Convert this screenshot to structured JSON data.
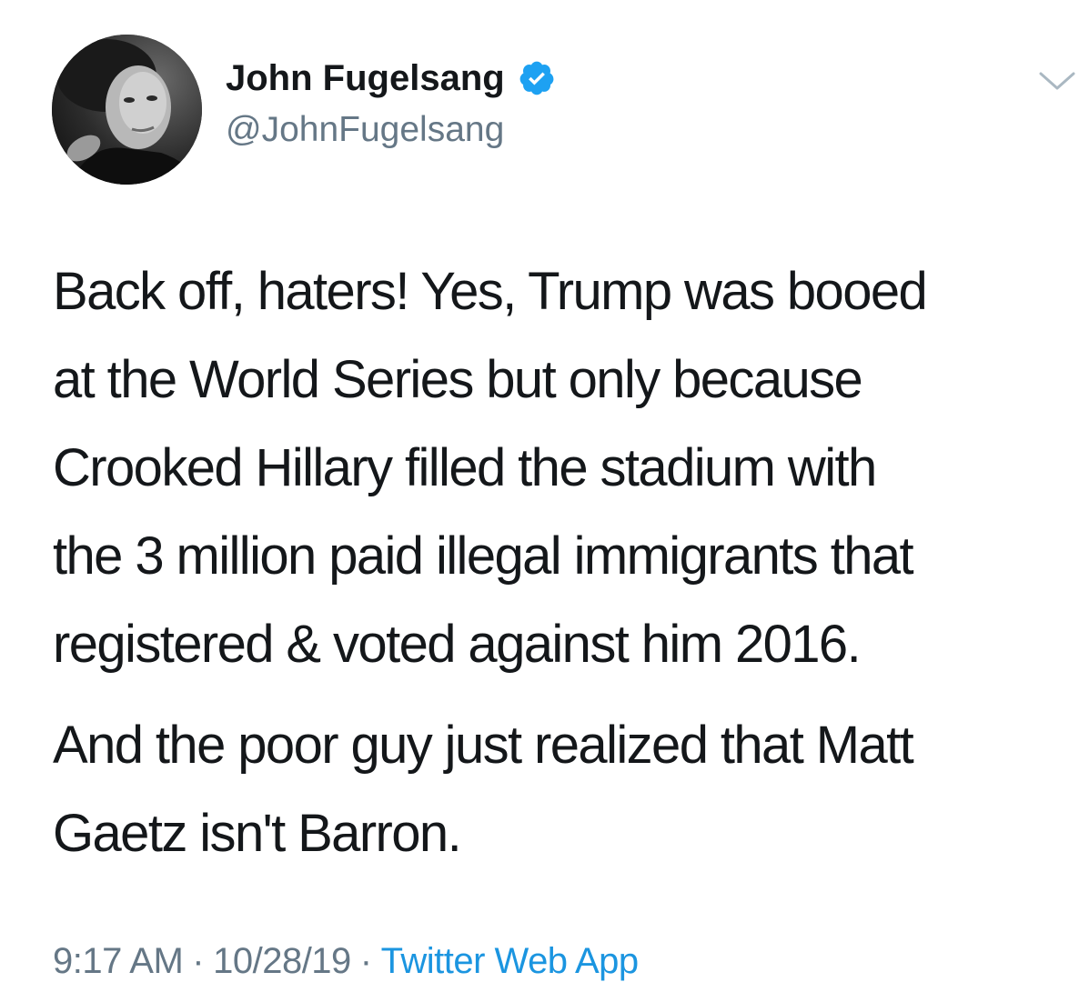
{
  "author": {
    "display_name": "John Fugelsang",
    "handle": "@JohnFugelsang",
    "verified": true,
    "avatar_icon": "profile-photo"
  },
  "tweet": {
    "paragraph_1": [
      "Back off, haters!  Yes, Trump was booed",
      "at the World Series but only because",
      "Crooked Hillary filled the stadium with",
      "the 3 million paid illegal immigrants that",
      "registered & voted against him 2016."
    ],
    "paragraph_2": [
      "And the poor guy just realized that Matt",
      "Gaetz isn't Barron."
    ]
  },
  "meta": {
    "time": "9:17 AM",
    "separator": "·",
    "date": "10/28/19",
    "source": "Twitter Web App"
  },
  "colors": {
    "text": "#14171a",
    "secondary": "#657786",
    "link": "#1b95e0",
    "verified_badge": "#1da1f2"
  },
  "icons": {
    "verified": "verified-badge-icon",
    "menu": "chevron-down-icon"
  }
}
